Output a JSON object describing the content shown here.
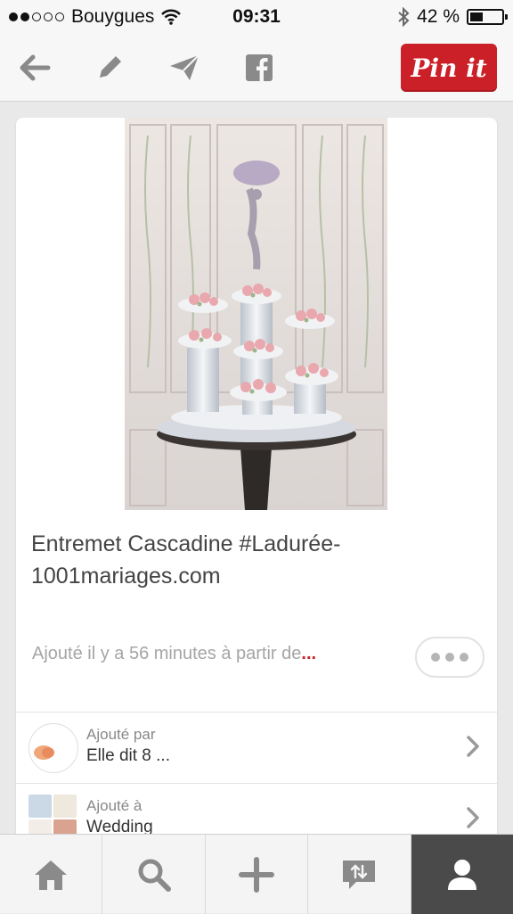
{
  "status_bar": {
    "signal_dots_filled": 2,
    "signal_dots_total": 5,
    "carrier": "Bouygues",
    "time": "09:31",
    "battery": "42 %",
    "battery_level": 0.42
  },
  "toolbar": {
    "icons": [
      "back-arrow-icon",
      "pencil-icon",
      "send-icon",
      "facebook-icon"
    ],
    "pin_it_label": "Pin it",
    "pin_it_color": "#cb2027"
  },
  "pin": {
    "title": "Entremet Cascadine #Ladurée-1001mariages.com",
    "meta_text": "Ajouté il y a 56 minutes à partir de",
    "meta_ellipsis": "..."
  },
  "added_by": {
    "label": "Ajouté par",
    "value": "Elle dit 8 ..."
  },
  "added_to": {
    "label": "Ajouté à",
    "value": "Wedding"
  },
  "tab_bar": {
    "tabs": [
      "home-icon",
      "search-icon",
      "add-icon",
      "news-icon",
      "profile-icon"
    ],
    "active_tab": "profile-icon"
  }
}
